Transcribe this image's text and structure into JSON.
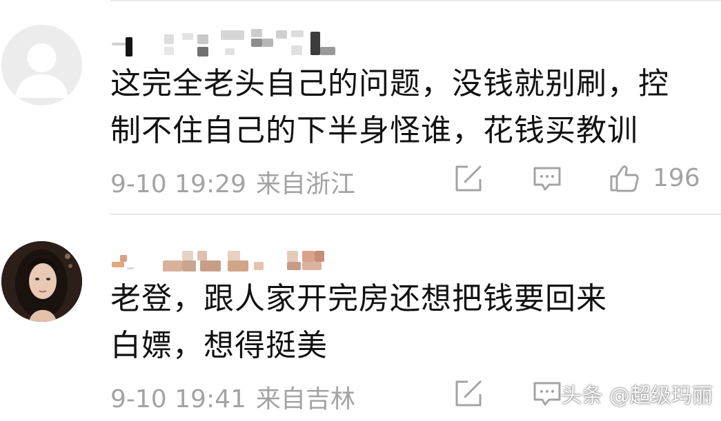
{
  "comments": [
    {
      "avatar": "default-avatar",
      "text_line_1": "这完全老头自己的问题，没钱就别刷，控",
      "text_line_2": "制不住自己的下半身怪谁，花钱买教训",
      "time": "9-10 19:29",
      "location": "来自浙江",
      "likes": "196"
    },
    {
      "avatar": "user-photo-avatar",
      "text_line_1": "老登，跟人家开完房还想把钱要回来",
      "text_line_2": "白嫖，想得挺美",
      "time": "9-10 19:41",
      "location": "来自吉林"
    }
  ],
  "icons": {
    "share": "share-edit-icon",
    "reply": "comment-bubble-icon",
    "like": "thumbs-up-icon"
  },
  "watermark": {
    "text": "头条 @超级玛丽"
  },
  "colors": {
    "text": "#111111",
    "meta": "#a3a3a3",
    "divider": "#e6e6e6"
  }
}
